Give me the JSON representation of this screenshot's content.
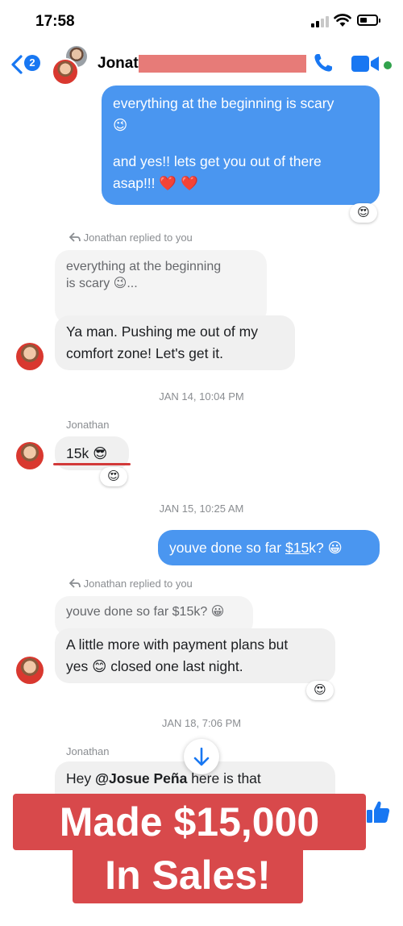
{
  "status_bar": {
    "time": "17:58"
  },
  "header": {
    "back_count": "2",
    "contact_name": "Jonat"
  },
  "messages": {
    "sent1_line1": "everything at the beginning is scary",
    "sent1_emoji": "😉",
    "sent1_line3": "and yes!! lets get you out of there",
    "sent1_line4": "asap!!! ❤️ ❤️",
    "sent1_reaction": "😍",
    "reply1_label": "Jonathan replied to you",
    "reply1_quote_line1": "everything at the beginning",
    "reply1_quote_line2": "is scary 😉...",
    "reply1_line1": "Ya man. Pushing me out of my",
    "reply1_line2": "comfort zone! Let's get it.",
    "timestamp1": "JAN 14, 10:04 PM",
    "sender_name1": "Jonathan",
    "msg_15k": "15k 😎",
    "msg_15k_reaction": "😍",
    "timestamp2": "JAN 15, 10:25 AM",
    "sent2_pre": "youve done so far ",
    "sent2_link": "$15",
    "sent2_post": "k? 😀",
    "reply2_label": "Jonathan replied to you",
    "reply2_quote": "youve done so far $15k? 😀",
    "reply2_line1": "A little more with payment plans but",
    "reply2_line2": "yes 😊 closed one last night.",
    "reply2_reaction": "😍",
    "timestamp3": "JAN 18, 7:06 PM",
    "sender_name2": "Jonathan",
    "last_pre": "Hey ",
    "last_mention": "@Josue Peña",
    "last_post": " here is that"
  },
  "overlay": {
    "banner_line1": "Made $15,000",
    "banner_line2": "In Sales!"
  },
  "colors": {
    "accent": "#1877f2",
    "sent_bubble": "#4a96f0",
    "banner": "#d8494b",
    "underline_mark": "#d23a3a"
  },
  "icons": [
    "back-chevron-icon",
    "phone-icon",
    "video-icon",
    "reply-arrow-icon",
    "arrow-down-icon",
    "thumbs-up-icon",
    "signal-icon",
    "wifi-icon",
    "battery-icon"
  ]
}
